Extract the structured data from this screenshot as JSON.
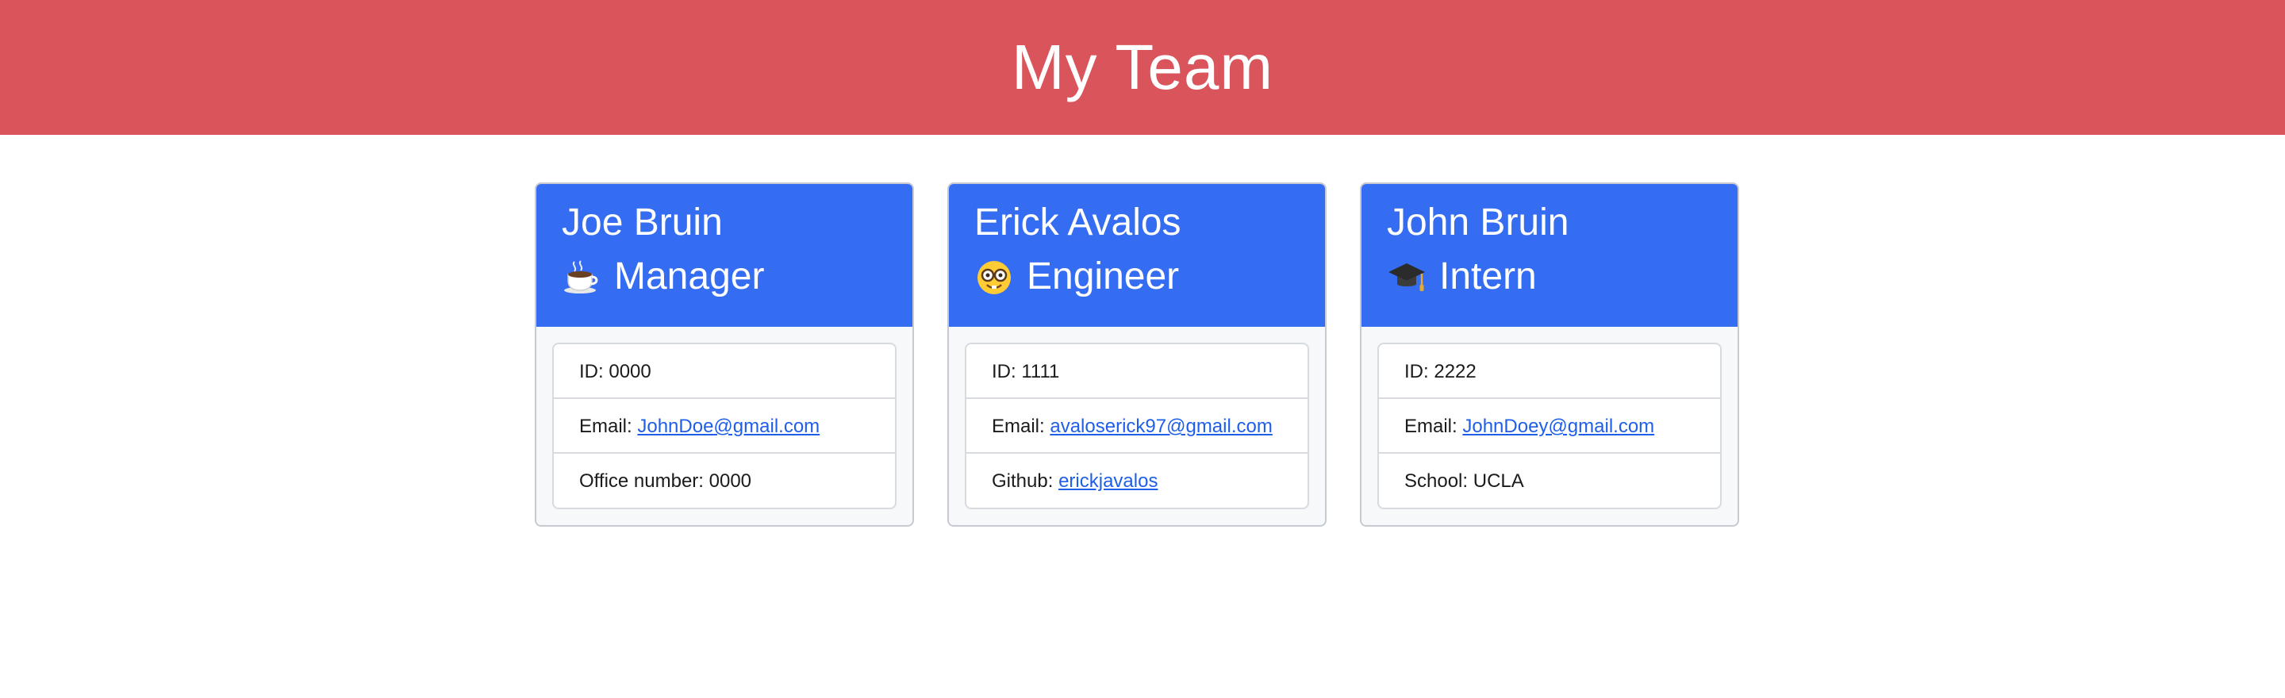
{
  "page": {
    "title": "My Team"
  },
  "colors": {
    "banner": "#d9545b",
    "card_header": "#356df2",
    "link": "#1f5fe8"
  },
  "employees": [
    {
      "name": "Joe Bruin",
      "role": "Manager",
      "role_icon": "coffee-icon",
      "id_label": "ID:",
      "id": "0000",
      "email_label": "Email:",
      "email": "JohnDoe@gmail.com",
      "extra_label": "Office number:",
      "extra_value": "0000"
    },
    {
      "name": "Erick Avalos",
      "role": "Engineer",
      "role_icon": "nerd-face-icon",
      "id_label": "ID:",
      "id": "1111",
      "email_label": "Email:",
      "email": "avaloserick97@gmail.com",
      "extra_label": "Github:",
      "extra_value": "erickjavalos"
    },
    {
      "name": "John Bruin",
      "role": "Intern",
      "role_icon": "graduation-cap-icon",
      "id_label": "ID:",
      "id": "2222",
      "email_label": "Email:",
      "email": "JohnDoey@gmail.com",
      "extra_label": "School:",
      "extra_value": "UCLA"
    }
  ]
}
